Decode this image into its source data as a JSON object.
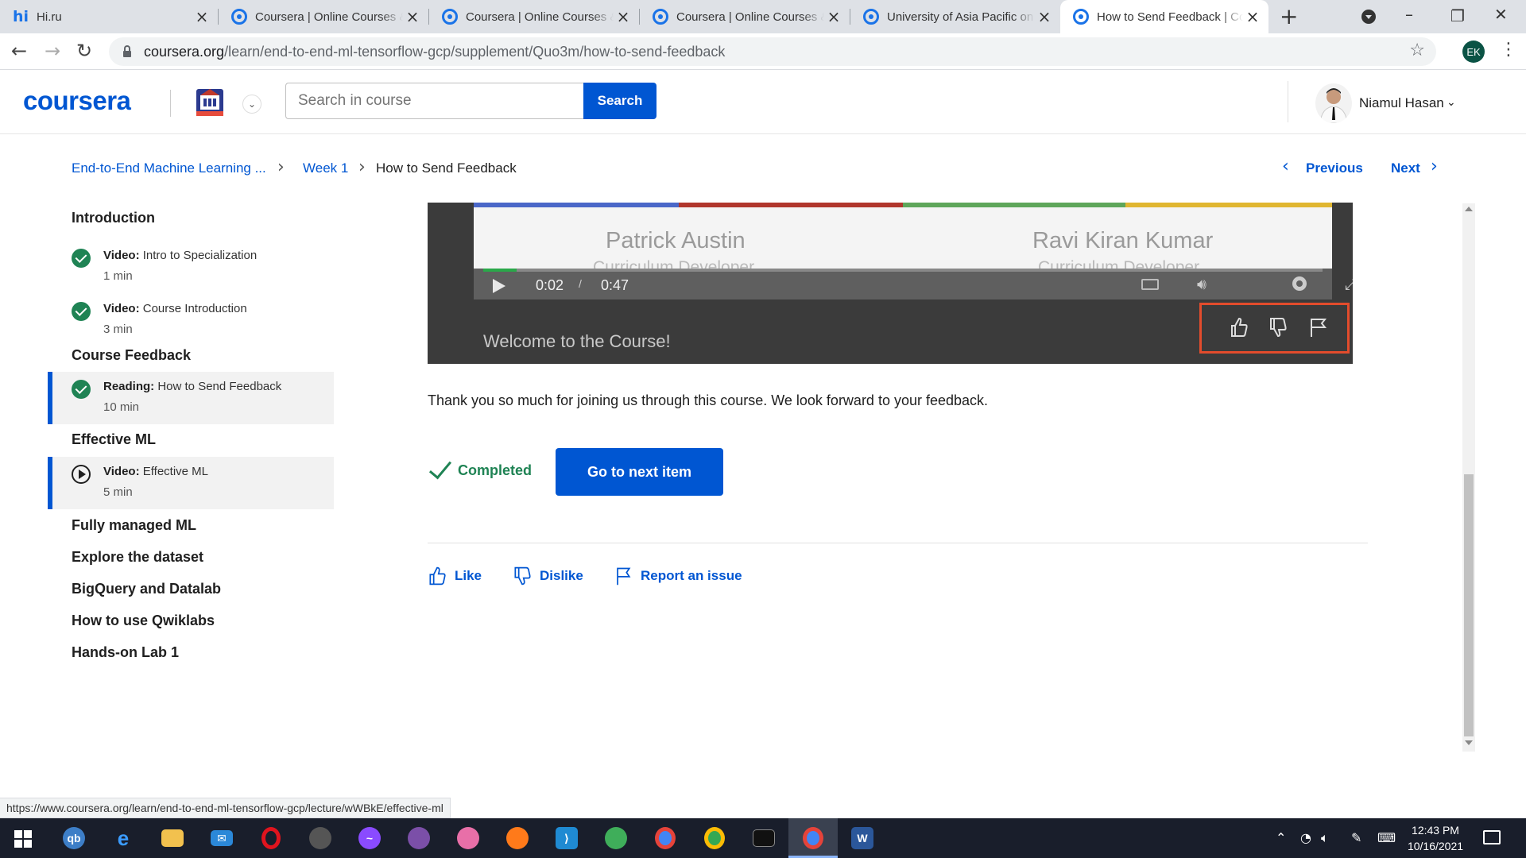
{
  "browser": {
    "tabs": [
      {
        "title": "Hi.ru",
        "icon": "hi-ru-icon"
      },
      {
        "title": "Coursera | Online Courses & Credentials",
        "icon": "chrome-icon"
      },
      {
        "title": "Coursera | Online Courses & Credentials",
        "icon": "chrome-icon"
      },
      {
        "title": "Coursera | Online Courses & Credentials",
        "icon": "chrome-icon"
      },
      {
        "title": "University of Asia Pacific on Coursera",
        "icon": "chrome-icon"
      },
      {
        "title": "How to Send Feedback | Coursera",
        "icon": "chrome-icon",
        "active": true
      }
    ],
    "url_host": "coursera.org",
    "url_path": "/learn/end-to-end-ml-tensorflow-gcp/supplement/Quo3m/how-to-send-feedback",
    "profile_initials": "EK",
    "status_url": "https://www.coursera.org/learn/end-to-end-ml-tensorflow-gcp/lecture/wWBkE/effective-ml"
  },
  "header": {
    "logo": "coursera",
    "search_placeholder": "Search in course",
    "search_button": "Search",
    "user_name": "Niamul Hasan"
  },
  "breadcrumb": {
    "course": "End-to-End Machine Learning ...",
    "week": "Week 1",
    "current": "How to Send Feedback",
    "previous": "Previous",
    "next": "Next"
  },
  "sidebar": {
    "sections": [
      {
        "title": "Introduction"
      },
      {
        "title": "Course Feedback"
      },
      {
        "title": "Effective ML"
      },
      {
        "title": "Fully managed ML"
      },
      {
        "title": "Explore the dataset"
      },
      {
        "title": "BigQuery and Datalab"
      },
      {
        "title": "How to use Qwiklabs"
      },
      {
        "title": "Hands-on Lab 1"
      }
    ],
    "items": [
      {
        "type": "Video:",
        "name": "Intro to Specialization",
        "duration": "1 min",
        "status": "completed"
      },
      {
        "type": "Video:",
        "name": "Course Introduction",
        "duration": "3 min",
        "status": "completed"
      },
      {
        "type": "Reading:",
        "name": "How to Send Feedback",
        "duration": "10 min",
        "status": "completed",
        "selected": true
      },
      {
        "type": "Video:",
        "name": "Effective ML",
        "duration": "5 min",
        "status": "not-started",
        "selected": true
      }
    ]
  },
  "video": {
    "presenters": [
      {
        "name": "Patrick Austin",
        "role": "Curriculum Developer"
      },
      {
        "name": "Ravi Kiran Kumar",
        "role": "Curriculum Developer"
      }
    ],
    "current_time": "0:02",
    "separator": "/",
    "duration": "0:47",
    "progress": 0.04,
    "caption": "Welcome to the Course!",
    "stripe_colors": [
      "#4a67c8",
      "#b0362c",
      "#5ea65a",
      "#e0b630"
    ],
    "highlight_color": "#e34c2c"
  },
  "content": {
    "body": "Thank you so much for joining us through this course.  We look forward to your feedback.",
    "completed_label": "Completed",
    "next_button": "Go to next item",
    "like": "Like",
    "dislike": "Dislike",
    "report": "Report an issue"
  },
  "taskbar": {
    "time": "12:43 PM",
    "date": "10/16/2021",
    "apps": [
      "qbittorrent-icon",
      "edge-icon",
      "file-explorer-icon",
      "mail-icon",
      "opera-icon",
      "inkscape-icon",
      "messenger-icon",
      "github-desktop-icon",
      "paint-icon",
      "firefox-icon",
      "vscode-icon",
      "earth-icon",
      "chrome-icon",
      "chrome-icon",
      "terminal-icon",
      "chrome-profile-icon",
      "word-icon"
    ]
  },
  "colors": {
    "brand": "#0056d2",
    "completed": "#1f8354"
  }
}
